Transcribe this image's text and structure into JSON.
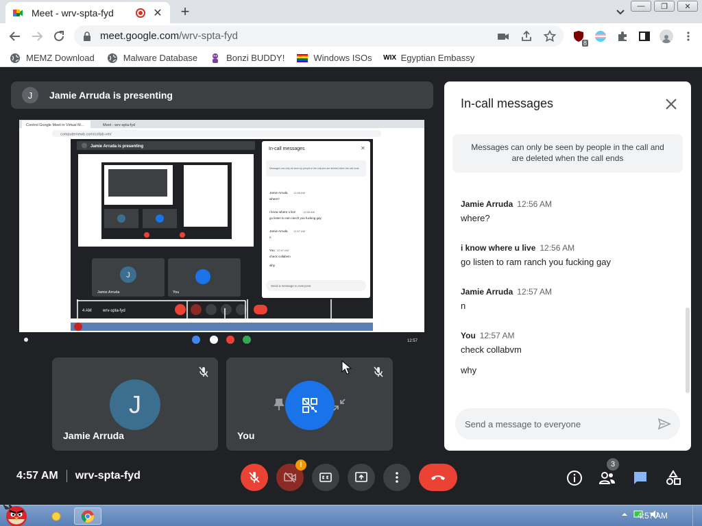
{
  "browser": {
    "tab_title": "Meet - wrv-spta-fyd",
    "tab_close": "✕",
    "new_tab": "+",
    "url_host": "meet.google.com",
    "url_path": "/wrv-spta-fyd",
    "extension_badge": "8",
    "window_buttons": [
      "—",
      "❐",
      "✕"
    ]
  },
  "bookmarks": [
    {
      "label": "MEMZ Download",
      "icon": "globe-icon"
    },
    {
      "label": "Malware Database",
      "icon": "globe-icon"
    },
    {
      "label": "Bonzi BUDDY!",
      "icon": "bonzi-icon"
    },
    {
      "label": "Windows ISOs",
      "icon": "rainbow-flag-icon"
    },
    {
      "label": "Egyptian Embassy",
      "icon": "wix-icon",
      "icon_text": "WIX"
    }
  ],
  "meet": {
    "presenting_avatar": "J",
    "presenting_text": "Jamie Arruda is presenting",
    "time": "4:57 AM",
    "meeting_code": "wrv-spta-fyd",
    "people_count": "3",
    "camera_warning": "!"
  },
  "tiles": [
    {
      "name": "Jamie Arruda",
      "avatar": "J",
      "avatar_color": "#3b6e8f"
    },
    {
      "name": "You",
      "avatar_color": "#1a73e8"
    }
  ],
  "chat": {
    "title": "In-call messages",
    "note": "Messages can only be seen by people in the call and are deleted when the call ends",
    "messages": [
      {
        "sender": "Jamie Arruda",
        "time": "12:56 AM",
        "lines": [
          "where?"
        ]
      },
      {
        "sender": "i know where u live",
        "time": "12:56 AM",
        "lines": [
          "go listen to ram ranch you fucking gay"
        ]
      },
      {
        "sender": "Jamie Arruda",
        "time": "12:57 AM",
        "lines": [
          "n"
        ]
      },
      {
        "sender": "You",
        "time": "12:57 AM",
        "lines": [
          "check collabvm",
          "why"
        ]
      }
    ],
    "input_placeholder": "Send a message to everyone"
  },
  "shared_screen": {
    "tab1": "Control Google Meet in Virtual M...",
    "tab2": "Meet - wrv-spta-fyd",
    "url": "computernewb.com/collab-vm/",
    "presenting_text": "Jamie Arruda is presenting",
    "chat_title": "In-call messages",
    "chat_note": "Messages can only be seen by people in the call and are deleted when the call ends",
    "messages": [
      {
        "sender": "Jamie Arruda",
        "time": "12:56 AM",
        "text": "where?"
      },
      {
        "sender": "i know where u live",
        "time": "12:56 AM",
        "text": "go listen to ram ranch you fucking gay"
      },
      {
        "sender": "Jamie Arruda",
        "time": "12:57 AM",
        "text": "n"
      },
      {
        "sender": "You",
        "time": "12:57 AM",
        "text": "check collabvm"
      },
      {
        "sender": "",
        "time": "",
        "text": "why"
      }
    ],
    "input_placeholder": "Send a message to everyone",
    "tile1_name": "Jamie Arruda",
    "tile1_avatar": "J",
    "tile2_name": "You",
    "bottom_time": "4 AM",
    "bottom_code": "wrv-spta-fyd",
    "shelf_time": "12:57"
  },
  "taskbar": {
    "time": "4:57 AM"
  },
  "colors": {
    "meet_bg": "#202124",
    "tile_bg": "#3c4043",
    "red": "#ea4335",
    "blue": "#1a73e8",
    "chat_icon_active": "#8ab4f8"
  }
}
